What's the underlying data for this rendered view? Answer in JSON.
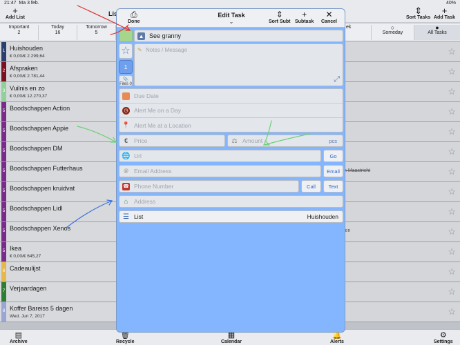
{
  "status": {
    "time": "21:47",
    "date": "Ma 3 feb.",
    "battery": "40%"
  },
  "topbar": {
    "add_list": "Add List",
    "title_left": "Lis",
    "sort_tasks": "Sort Tasks",
    "add_task": "Add Task"
  },
  "segments": [
    {
      "label": "Important",
      "count": "2"
    },
    {
      "label": "Today",
      "count": "16"
    },
    {
      "label": "Tomorrow",
      "count": "5"
    },
    {
      "label": "ek",
      "count": ""
    },
    {
      "label": "Someday",
      "count": ""
    },
    {
      "label": "All Tasks",
      "count": ""
    }
  ],
  "lists": [
    {
      "name": "Huishouden",
      "sub": "€ 0,00/€ 2.299,64",
      "num": "1",
      "color": "#2c3e6e"
    },
    {
      "name": "Afspraken",
      "sub": "€ 0,00/€ 2.781,44",
      "num": "2",
      "color": "#7a1020"
    },
    {
      "name": "Vuilnis en zo",
      "sub": "€ 0,00/€ 12.270,37",
      "num": "3",
      "color": "#8fd19a"
    },
    {
      "name": "Boodschappen Action",
      "sub": "",
      "num": "5",
      "color": "#7a2a8a"
    },
    {
      "name": "Boodschappen Appie",
      "sub": "",
      "num": "5",
      "color": "#7a2a8a"
    },
    {
      "name": "Boodschappen DM",
      "sub": "",
      "num": "5",
      "color": "#7a2a8a"
    },
    {
      "name": "Boodschappen Futterhaus",
      "sub": "",
      "num": "5",
      "color": "#7a2a8a"
    },
    {
      "name": "Boodschappen kruidvat",
      "sub": "",
      "num": "5",
      "color": "#7a2a8a"
    },
    {
      "name": "Boodschappen Lidl",
      "sub": "",
      "num": "5",
      "color": "#7a2a8a"
    },
    {
      "name": "Boodschappen Xenos",
      "sub": "",
      "num": "5",
      "color": "#7a2a8a"
    },
    {
      "name": "Ikea",
      "sub": "€ 0,00/€ 645,27",
      "num": "5",
      "color": "#7a2a8a"
    },
    {
      "name": "Cadeaulijst",
      "sub": "",
      "num": "6",
      "color": "#e6b84a"
    },
    {
      "name": "Verjaardagen",
      "sub": "",
      "num": "7",
      "color": "#2e7d32"
    },
    {
      "name": "Koffer Bareiss 5 dagen",
      "sub": "Wed. Jun 7, 2017",
      "num": "8",
      "color": "#9aa5d6"
    }
  ],
  "right_rows": [
    "",
    "",
    "",
    "",
    "",
    "",
    "n Maastricht",
    "",
    "",
    "len",
    "",
    "",
    "",
    ""
  ],
  "bottom": {
    "archive": "Archive",
    "recycle": "Recycle",
    "calendar": "Calendar",
    "alerts": "Alerts",
    "settings": "Settings"
  },
  "modal": {
    "title": "Edit Task",
    "done": "Done",
    "sort_subt": "Sort Subt",
    "subtask": "Subtask",
    "cancel": "Cancel",
    "task_title": "See granny",
    "notes_placeholder": "Notes / Message",
    "priority": "1",
    "files": "Files 0",
    "due_date": "Due Date",
    "alert_day": "Alert Me on a Day",
    "alert_location": "Alert Me at a Location",
    "price": "Price",
    "amount": "Amount",
    "unit": "pcs",
    "url": "Url",
    "go": "Go",
    "email": "Email Address",
    "email_btn": "Email",
    "phone": "Phone Number",
    "call": "Call",
    "text": "Text",
    "address": "Address",
    "list_label": "List",
    "list_value": "Huishouden"
  }
}
